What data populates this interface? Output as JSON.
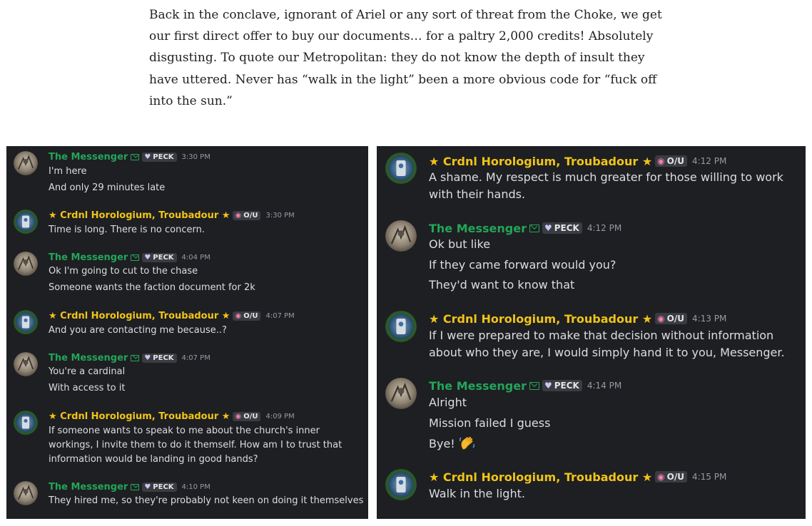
{
  "article": {
    "paragraph": "Back in the conclave, ignorant of Ariel or any sort of threat from the Choke, we get our first direct offer to buy our documents… for a paltry 2,000 credits! Absolutely disgusting. To quote our Metropolitan: they do not know the depth of insult they have uttered. Never has “walk in the light” been a more obvious code for “fuck off into the sun.”"
  },
  "users": {
    "messenger": {
      "name": "The Messenger",
      "tag": "PECK",
      "color": "#23a55a",
      "icon": "envelope-icon",
      "tag_icon": "heart-icon"
    },
    "cardinal": {
      "name": "★ Crdnl Horologium, Troubadour ★",
      "tag": "O/U",
      "color": "#f0c419",
      "tag_icon": "skull-icon"
    }
  },
  "left_chat": [
    {
      "time": "3:30 PM",
      "lines": [
        "I'm here",
        "And only 29 minutes late"
      ]
    },
    {
      "time": "3:30 PM",
      "lines": [
        "Time is long. There is no concern."
      ]
    },
    {
      "time": "4:04 PM",
      "lines": [
        "Ok I'm going to cut to the chase",
        "Someone wants the faction document for 2k"
      ]
    },
    {
      "time": "4:07 PM",
      "lines": [
        "And you are contacting me because..?"
      ]
    },
    {
      "time": "4:07 PM",
      "lines": [
        "You're a cardinal",
        "With access to it"
      ]
    },
    {
      "time": "4:09 PM",
      "lines": [
        "If someone wants to speak to me about the church's inner workings, I invite them to do it themself. How am I to trust that information would be landing in good hands?"
      ]
    },
    {
      "time": "4:10 PM",
      "lines": [
        "They hired me, so they're probably not keen on doing it themselves"
      ]
    }
  ],
  "right_chat": [
    {
      "time": "4:12 PM",
      "lines": [
        "A shame. My respect is much greater for those willing to work with their hands."
      ]
    },
    {
      "time": "4:12 PM",
      "lines": [
        "Ok but like",
        "If they came forward would you?",
        "They'd want to know that"
      ]
    },
    {
      "time": "4:13 PM",
      "lines": [
        "If I were prepared to make that decision without information about who they are, I would simply hand it to you, Messenger."
      ]
    },
    {
      "time": "4:14 PM",
      "lines": [
        "Alright",
        "Mission failed I guess",
        "Bye!"
      ]
    },
    {
      "time": "4:15 PM",
      "lines": [
        "Walk in the light."
      ]
    }
  ]
}
